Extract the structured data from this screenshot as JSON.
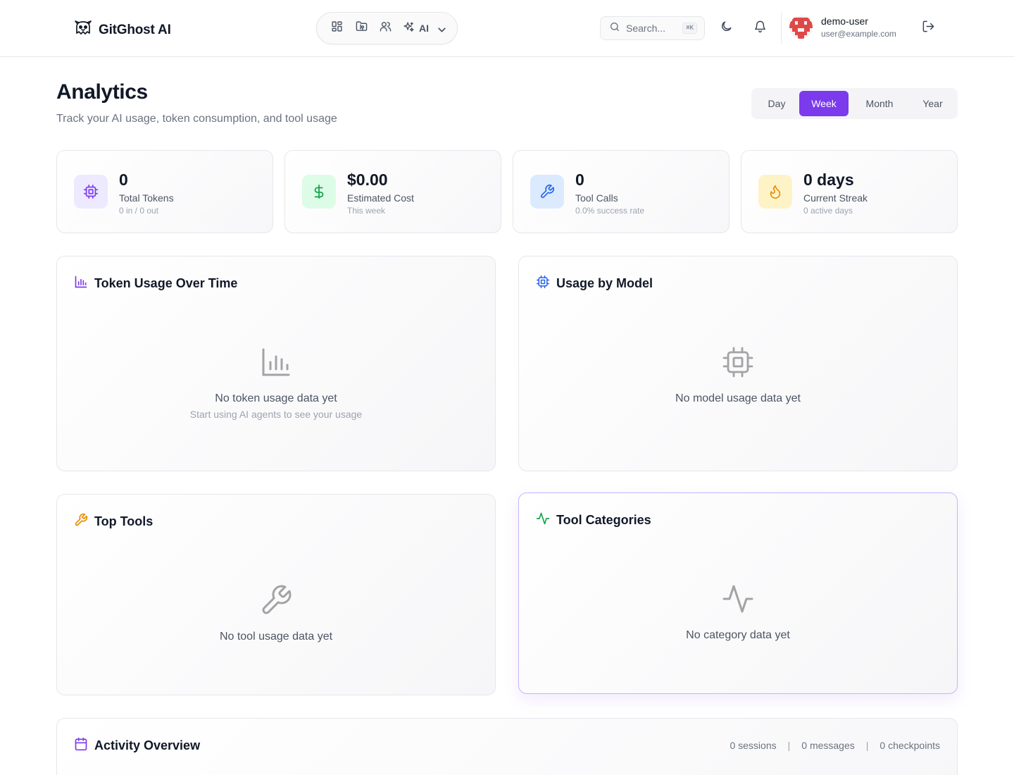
{
  "app": {
    "name": "GitGhost AI"
  },
  "nav": {
    "items": [
      {
        "icon": "dashboard-icon"
      },
      {
        "icon": "folder-git-icon"
      },
      {
        "icon": "users-icon"
      }
    ],
    "ai_label": "AI"
  },
  "search": {
    "placeholder": "Search...",
    "shortcut": "⌘K"
  },
  "user": {
    "name": "demo-user",
    "email": "user@example.com"
  },
  "page": {
    "title": "Analytics",
    "subtitle": "Track your AI usage, token consumption, and tool usage"
  },
  "range": {
    "options": [
      "Day",
      "Week",
      "Month",
      "Year"
    ],
    "selected": "Week"
  },
  "stats": [
    {
      "icon": "cpu-icon",
      "value": "0",
      "label": "Total Tokens",
      "sub": "0 in / 0 out",
      "color": "#7c3aed",
      "bg": "#ede9fe"
    },
    {
      "icon": "dollar-icon",
      "value": "$0.00",
      "label": "Estimated Cost",
      "sub": "This week",
      "color": "#16a34a",
      "bg": "#dcfce7"
    },
    {
      "icon": "wrench-icon",
      "value": "0",
      "label": "Tool Calls",
      "sub": "0.0% success rate",
      "color": "#2563eb",
      "bg": "#dbeafe"
    },
    {
      "icon": "flame-icon",
      "value": "0 days",
      "label": "Current Streak",
      "sub": "0 active days",
      "color": "#ea8a04",
      "bg": "#fef3c7"
    }
  ],
  "panels": {
    "token_usage": {
      "title": "Token Usage Over Time",
      "empty": "No token usage data yet",
      "empty_sub": "Start using AI agents to see your usage",
      "accent": "#7c3aed"
    },
    "usage_by_model": {
      "title": "Usage by Model",
      "empty": "No model usage data yet",
      "accent": "#2563eb"
    },
    "top_tools": {
      "title": "Top Tools",
      "empty": "No tool usage data yet",
      "accent": "#ea8a04"
    },
    "tool_categories": {
      "title": "Tool Categories",
      "empty": "No category data yet",
      "accent": "#16a34a"
    }
  },
  "activity": {
    "title": "Activity Overview",
    "sessions": "0 sessions",
    "messages": "0 messages",
    "checkpoints": "0 checkpoints",
    "separator": "|"
  }
}
